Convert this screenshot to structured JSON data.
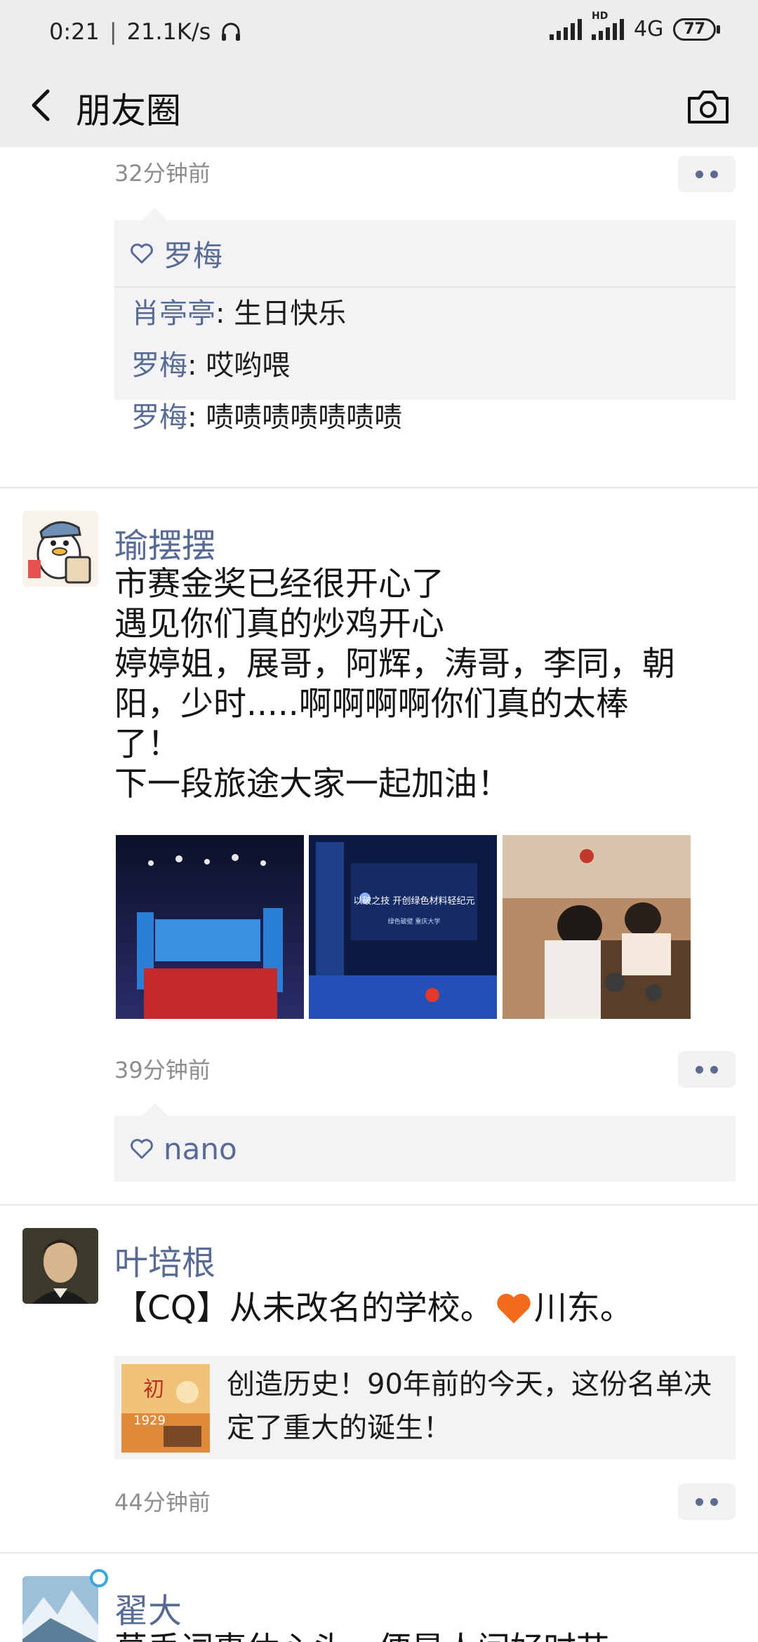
{
  "status_bar": {
    "time": "0:21",
    "separator": "|",
    "net_speed": "21.1K/s",
    "hd_label": "HD",
    "network": "4G",
    "battery": "77"
  },
  "nav": {
    "title": "朋友圈",
    "back_icon": "chevron-left-icon",
    "camera_icon": "camera-icon"
  },
  "posts": [
    {
      "time": "32分钟前",
      "likes": "罗梅",
      "comments": [
        {
          "name": "肖亭亭",
          "text": ": 生日快乐"
        },
        {
          "name": "罗梅",
          "text": ": 哎哟喂"
        },
        {
          "name": "罗梅",
          "text": ": 啧啧啧啧啧啧啧"
        }
      ]
    },
    {
      "user": "瑜摆摆",
      "text": "市赛金奖已经很开心了\n遇见你们真的炒鸡开心\n婷婷姐，展哥，阿辉，涛哥，李同，朝\n阳，少时.....啊啊啊啊你们真的太棒\n了！\n下一段旅途大家一起加油！",
      "photos": [
        {
          "caption": "紫色背景的奖台照片"
        },
        {
          "caption": "以破之技 开创绿色材料轻纪元",
          "sub": "绿色破壁 重庆大学"
        },
        {
          "caption": "聚餐照片"
        }
      ],
      "time": "39分钟前",
      "likes": "nano"
    },
    {
      "user": "叶培根",
      "text": "【CQ】从未改名的学校。",
      "text_after": "川东。",
      "share_text": "创造历史！90年前的今天，这份名单决定了重大的诞生！",
      "share_thumb_year": "1929",
      "share_thumb_char": "初",
      "time": "44分钟前"
    },
    {
      "user": "翟大",
      "text": "莫丢词事休心头，便是人间好时节"
    }
  ]
}
